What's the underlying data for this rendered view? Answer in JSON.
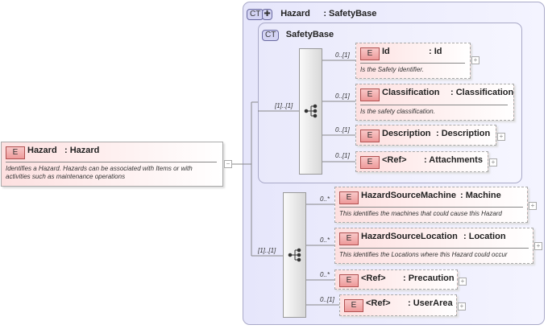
{
  "root": {
    "badge": "E",
    "name": "Hazard",
    "type": ": Hazard",
    "doc1": "Identifies a Hazard. Hazards can be associated with Items  or with",
    "doc2": "activities such as maintenance operations"
  },
  "outer": {
    "badge": "CT",
    "name": "Hazard",
    "type": ": SafetyBase"
  },
  "inner": {
    "badge": "CT",
    "name": "SafetyBase"
  },
  "seq1": {
    "card": "[1]..[1]",
    "items": [
      {
        "badge": "E",
        "name": "Id",
        "type": ": Id",
        "card": "0..[1]",
        "doc": "Is the Safety identifier."
      },
      {
        "badge": "E",
        "name": "Classification",
        "type": ": Classification",
        "card": "0..[1]",
        "doc": "Is the safety classification."
      },
      {
        "badge": "E",
        "name": "Description",
        "type": ": Description",
        "card": "0..[1]"
      },
      {
        "badge": "E",
        "name": "<Ref>",
        "type": ": Attachments",
        "card": "0..[1]"
      }
    ]
  },
  "seq2": {
    "card": "[1]..[1]",
    "items": [
      {
        "badge": "E",
        "name": "HazardSourceMachine",
        "type": ": Machine",
        "card": "0..*",
        "doc": "This identifies the machines that could cause this Hazard"
      },
      {
        "badge": "E",
        "name": "HazardSourceLocation",
        "type": ": Location",
        "card": "0..*",
        "doc": "This identifies the Locations where this Hazard could occur"
      },
      {
        "badge": "E",
        "name": "<Ref>",
        "type": ": Precaution",
        "card": "0..*"
      },
      {
        "badge": "E",
        "name": "<Ref>",
        "type": ": UserArea",
        "card": "0..[1]"
      }
    ]
  },
  "expand": "+",
  "collapse": "−"
}
